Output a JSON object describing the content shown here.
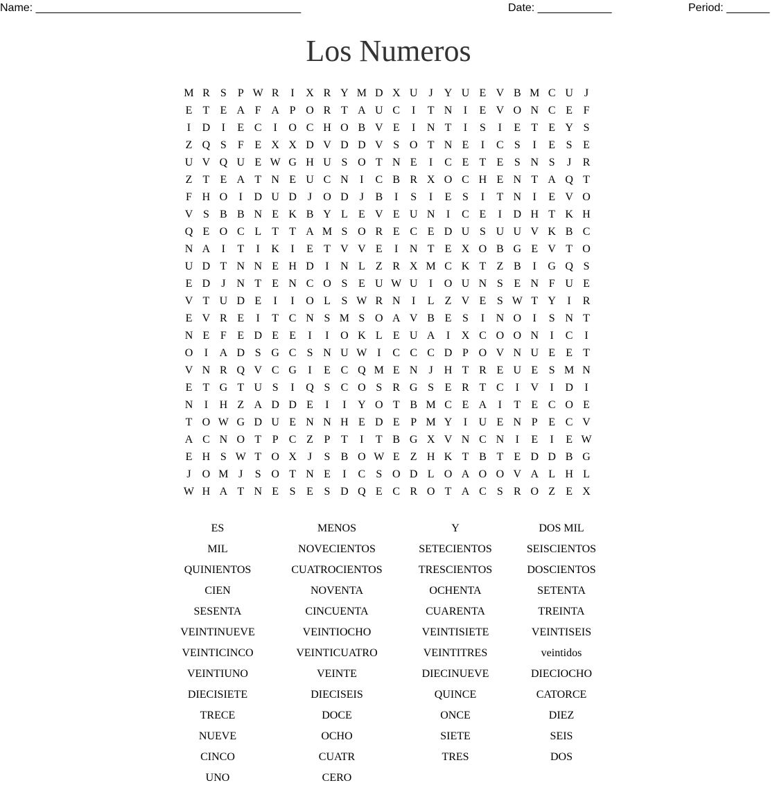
{
  "header": {
    "name_label": "Name: ___________________________________________",
    "date_label": "Date: ____________",
    "period_label": "Period: _______"
  },
  "title": "Los Numeros",
  "grid": [
    "MRSPWRIXRYMDXUJYUEVBMCUJ",
    "ETEAFAPORTAUCITNIEVONCEF",
    "IDIECIOCHOBVEINTISIETEYS",
    "ZQSFEXXDVDDVSOTNEICSIESE",
    "UVQUEWGHUSOTNEICETESNSJR",
    "ZTEATNEUCNICBRXOCHENTAQT",
    "FHOIDUDJODJBISIESITNIEVO",
    "VSBBNEKBYLEVEUNICEIDHTKH",
    "QEOCLTTAMSORECEDUSUUVKBC",
    "NAITIKIETVVEINTEXOBGEVTO",
    "UDTNNEHDINLZRXMCKTZBIGQS",
    "EDJNTENCOSEUWUIOUNSENFUE",
    "VTUDEIIOLSWRNILZVESWTYIR",
    "EVREITCNSMSOAVBESINOISNT",
    "NEFEDEEIIOKLEUAIXCOONICI",
    "OIADSGCSNUWICCCDPOVNUEET",
    "VNRQVCGIECQMENJHTREUESMN",
    "ETGTUSIQSCOSRGSERTCIVIDI",
    "NIHZADDEIIYOTBMCEAITECOE",
    "TOWGDUENNHEDEPMYIUENPECV",
    "ACNOTPCZPTITBGXVNCNIEIEW",
    "EHSWTOXJSBOWEZHKTBTEDDBG",
    "JOMJSOTNEICSODLOAOOVALHL",
    "WHATNESESDQECROTACSROZEX"
  ],
  "word_list": [
    [
      "ES",
      "MENOS",
      "Y",
      "DOS MIL"
    ],
    [
      "MIL",
      "NOVECIENTOS",
      "SETECIENTOS",
      "SEISCIENTOS"
    ],
    [
      "QUINIENTOS",
      "CUATROCIENTOS",
      "TRESCIENTOS",
      "DOSCIENTOS"
    ],
    [
      "CIEN",
      "NOVENTA",
      "OCHENTA",
      "SETENTA"
    ],
    [
      "SESENTA",
      "CINCUENTA",
      "CUARENTA",
      "TREINTA"
    ],
    [
      "VEINTINUEVE",
      "VEINTIOCHO",
      "VEINTISIETE",
      "VEINTISEIS"
    ],
    [
      "VEINTICINCO",
      "VEINTICUATRO",
      "VEINTITRES",
      "veintidos"
    ],
    [
      "VEINTIUNO",
      "VEINTE",
      "DIECINUEVE",
      "DIECIOCHO"
    ],
    [
      "DIECISIETE",
      "DIECISEIS",
      "QUINCE",
      "CATORCE"
    ],
    [
      "TRECE",
      "DOCE",
      "ONCE",
      "DIEZ"
    ],
    [
      "NUEVE",
      "OCHO",
      "SIETE",
      "SEIS"
    ],
    [
      "CINCO",
      "CUATR",
      "TRES",
      "DOS"
    ],
    [
      "UNO",
      "CERO"
    ]
  ]
}
